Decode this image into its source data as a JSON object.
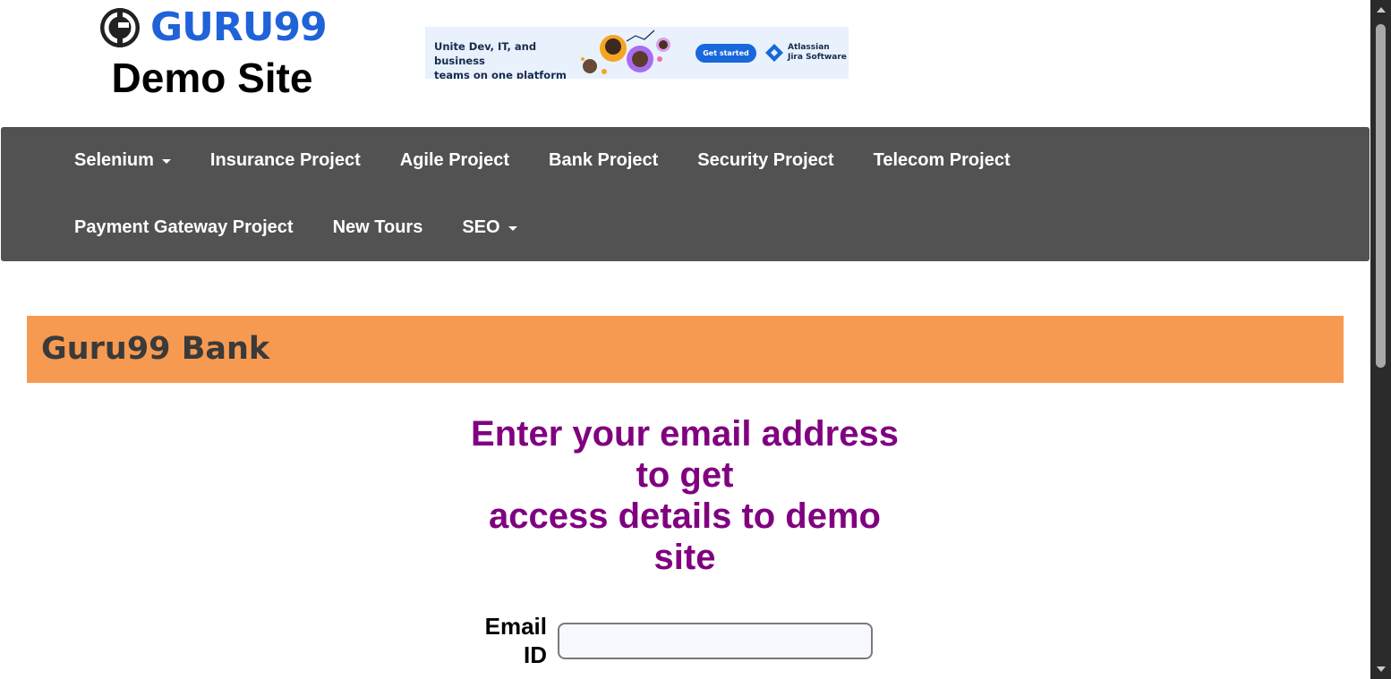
{
  "logo": {
    "text": "GURU99",
    "subtitle": "Demo Site"
  },
  "banner": {
    "text_line1": "Unite Dev, IT, and business",
    "text_line2": "teams on one platform",
    "button": "Get started",
    "brand_line1": "Atlassian",
    "brand_line2": "Jira Software"
  },
  "nav": {
    "row1": [
      {
        "label": "Selenium",
        "dropdown": true
      },
      {
        "label": "Insurance Project",
        "dropdown": false
      },
      {
        "label": "Agile Project",
        "dropdown": false
      },
      {
        "label": "Bank Project",
        "dropdown": false
      },
      {
        "label": "Security Project",
        "dropdown": false
      },
      {
        "label": "Telecom Project",
        "dropdown": false
      }
    ],
    "row2": [
      {
        "label": "Payment Gateway Project",
        "dropdown": false
      },
      {
        "label": "New Tours",
        "dropdown": false
      },
      {
        "label": "SEO",
        "dropdown": true
      }
    ]
  },
  "bank": {
    "title": "Guru99 Bank"
  },
  "form": {
    "heading_line1": "Enter your email address",
    "heading_line2": "to get",
    "heading_line3": "access details to demo",
    "heading_line4": "site",
    "email_label_line1": "Email",
    "email_label_line2": "ID",
    "email_value": "",
    "email_placeholder": ""
  },
  "colors": {
    "nav_bg": "#525252",
    "bank_bar": "#f79a51",
    "heading": "#800080",
    "logo_blue": "#2062d8"
  }
}
